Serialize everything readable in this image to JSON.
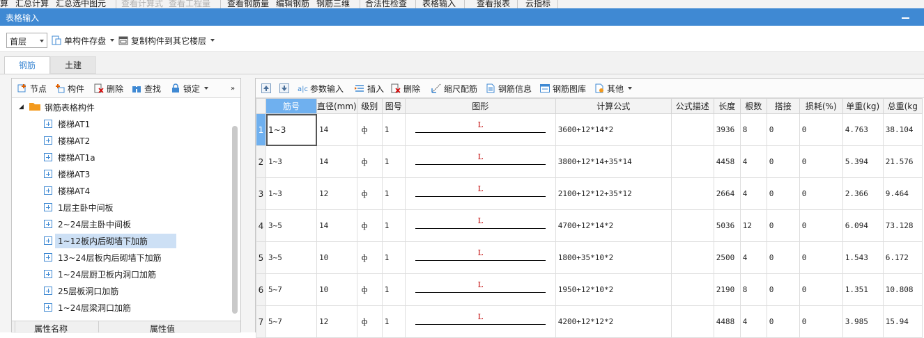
{
  "ribbon": {
    "items": [
      {
        "label": "算",
        "enabled": true
      },
      {
        "label": "汇总计算",
        "enabled": true
      },
      {
        "label": "汇总选中图元",
        "enabled": true
      },
      {
        "label": "查看计算式",
        "enabled": false
      },
      {
        "label": "查看工程量",
        "enabled": false
      },
      {
        "label": "查看钢筋量",
        "enabled": true
      },
      {
        "label": "编辑钢筋",
        "enabled": true
      },
      {
        "label": "钢筋三维",
        "enabled": true
      },
      {
        "label": "合法性检查",
        "enabled": true
      },
      {
        "label": "表格输入",
        "enabled": true
      },
      {
        "label": "查看报表",
        "enabled": true
      },
      {
        "label": "云指标",
        "enabled": true
      }
    ]
  },
  "window": {
    "title": "表格输入",
    "accent": "#3f89d3"
  },
  "floorbar": {
    "floor": "首层",
    "save_label": "单构件存盘",
    "copy_label": "复制构件到其它楼层"
  },
  "tabs": [
    {
      "label": "钢筋",
      "active": true
    },
    {
      "label": "土建",
      "active": false
    }
  ],
  "left_toolbar": {
    "node": "节点",
    "component": "构件",
    "delete": "删除",
    "find": "查找",
    "lock": "锁定"
  },
  "tree": {
    "root": "钢筋表格构件",
    "items": [
      "楼梯AT1",
      "楼梯AT2",
      "楼梯AT1a",
      "楼梯AT3",
      "楼梯AT4",
      "1层主卧中间板",
      "2~24层主卧中间板",
      "1~12板内后砌墙下加筋",
      "13~24层板内后砌墙下加筋",
      "1~24层厨卫板内洞口加筋",
      "25层板洞口加筋",
      "1~24层梁洞口加筋"
    ],
    "selected_index": 7
  },
  "properties": {
    "name_header": "属性名称",
    "value_header": "属性值"
  },
  "right_toolbar": {
    "param_input": "参数输入",
    "insert": "插入",
    "delete": "删除",
    "scale": "缩尺配筋",
    "rebar_info": "钢筋信息",
    "rebar_library": "钢筋图库",
    "other": "其他"
  },
  "grid": {
    "headers": [
      "筋号",
      "直径(mm)",
      "级别",
      "图号",
      "图形",
      "计算公式",
      "公式描述",
      "长度",
      "根数",
      "搭接",
      "损耗(%)",
      "单重(kg)",
      "总重(kg"
    ],
    "shape_label": "L",
    "grade_symbol": "ф",
    "rows": [
      {
        "no": "1",
        "bar": "1~3",
        "dia": "14",
        "fig": "1",
        "formula": "3600+12*14*2",
        "len": "3936",
        "count": "8",
        "lap": "0",
        "loss": "0",
        "unit": "4.763",
        "total": "38.104"
      },
      {
        "no": "2",
        "bar": "1~3",
        "dia": "14",
        "fig": "1",
        "formula": "3800+12*14+35*14",
        "len": "4458",
        "count": "4",
        "lap": "0",
        "loss": "0",
        "unit": "5.394",
        "total": "21.576"
      },
      {
        "no": "3",
        "bar": "1~3",
        "dia": "12",
        "fig": "1",
        "formula": "2100+12*12+35*12",
        "len": "2664",
        "count": "4",
        "lap": "0",
        "loss": "0",
        "unit": "2.366",
        "total": "9.464"
      },
      {
        "no": "4",
        "bar": "3~5",
        "dia": "14",
        "fig": "1",
        "formula": "4700+12*14*2",
        "len": "5036",
        "count": "12",
        "lap": "0",
        "loss": "0",
        "unit": "6.094",
        "total": "73.128"
      },
      {
        "no": "5",
        "bar": "3~5",
        "dia": "10",
        "fig": "1",
        "formula": "1800+35*10*2",
        "len": "2500",
        "count": "4",
        "lap": "0",
        "loss": "0",
        "unit": "1.543",
        "total": "6.172"
      },
      {
        "no": "6",
        "bar": "5~7",
        "dia": "10",
        "fig": "1",
        "formula": "1950+12*10*2",
        "len": "2190",
        "count": "8",
        "lap": "0",
        "loss": "0",
        "unit": "1.351",
        "total": "10.808"
      },
      {
        "no": "7",
        "bar": "5~7",
        "dia": "12",
        "fig": "1",
        "formula": "4200+12*12*2",
        "len": "4488",
        "count": "4",
        "lap": "0",
        "loss": "0",
        "unit": "3.985",
        "total": "15.94"
      }
    ]
  }
}
